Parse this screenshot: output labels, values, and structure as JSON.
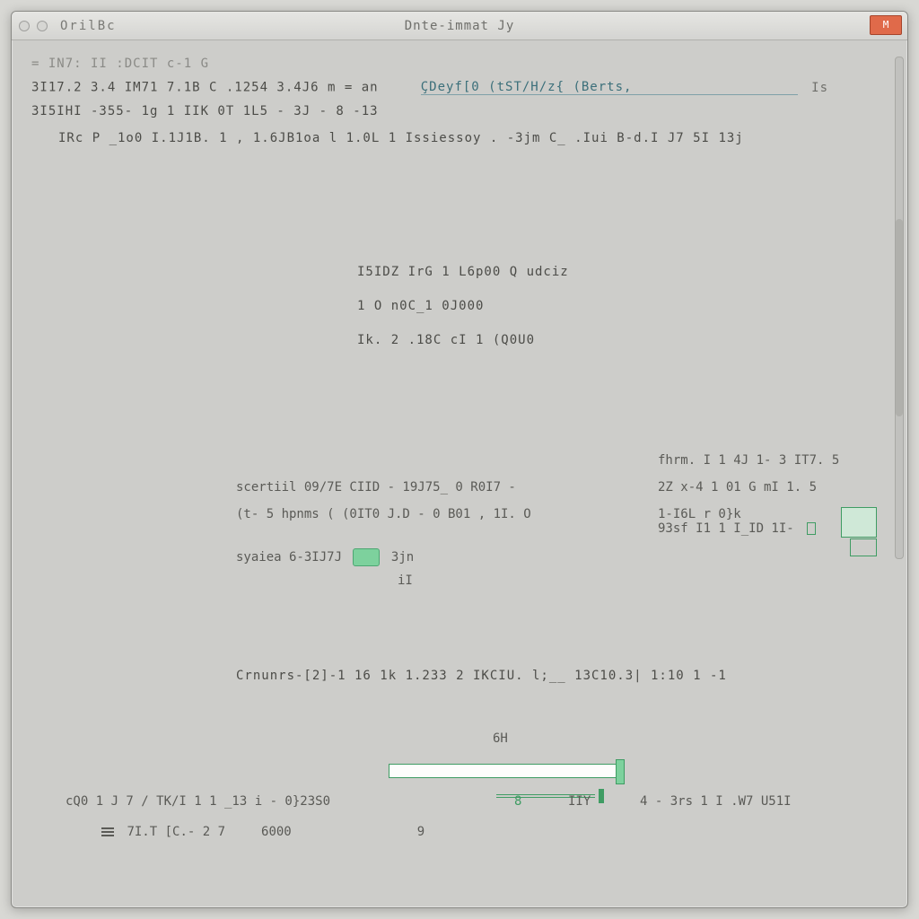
{
  "titlebar": {
    "app_name": "OrilBc",
    "title": "Dnte-immat   Jy",
    "close_label": "M"
  },
  "top": {
    "line1": "= IN7: II  :DCIT  c-1 G",
    "line2_left": "3I17.2 3.4 IM71  7.1B C  .1254  3.4J6  m  =  an",
    "line2_link": "ÇDeyf[0 (tST/H/z{ (Berts,",
    "line2_tail": "Is",
    "line3": "3I5IHI    -355- 1g  1 IIK 0T  1L5 - 3J  - 8 -13",
    "line4": "IRc  P  _1o0  I.1J1B.  1  , 1.6JB1oa l   1.0L 1 Issiessoy .  -3jm C_  .Iui B-d.I J7 5I 13j"
  },
  "center": {
    "c1": "I5IDZ IrG 1  L6p00  Q  udciz",
    "c2": "1 O  n0C_1 0J000",
    "c3": "Ik. 2 .18C cI 1 (Q0U0"
  },
  "mid": {
    "row1_right": "fhrm. I 1    4J 1- 3   IT7.  5",
    "row2_left": "scertiil 09/7E CIID - 19J75_ 0 R0I7   -",
    "row2_right": "2Z x-4 1    01  G   mI 1.  5",
    "row3_left": "(t- 5  hpnms ( (0IT0 J.D - 0 B01 , 1I.   O",
    "row3_right": "1-I6L r   0}k",
    "row3_right2": "93sf I1  1    I_ID 1I-",
    "row4_left_a": "syaiea 6-3IJ7J",
    "row4_left_b": "3jn",
    "row4_sub": "iI"
  },
  "lower": {
    "l1": "Crnunrs-[2]-1 16 1k 1.233 2 IKCIU.      l;__ 13C10.3|  1:10 1  -1"
  },
  "progress": {
    "h_label": "6H",
    "tick_a": "8",
    "tick_b": "IIY"
  },
  "bottom": {
    "r1_a": "cQ0 1 J 7 / TK/I 1 1   _13        i  -   0}23S0",
    "r1_b": "4 -   3rs  1 I .W7 U51I",
    "r2_a": "7I.T   [C.- 2 7",
    "r2_b": "6000",
    "r2_c": "9"
  }
}
